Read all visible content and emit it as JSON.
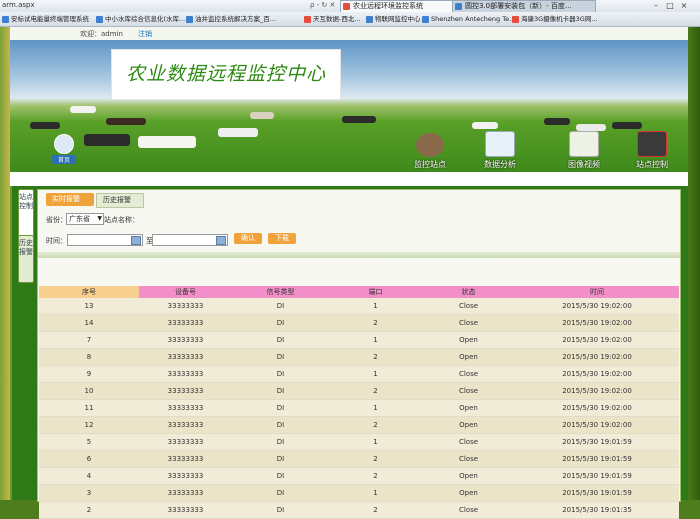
{
  "browser": {
    "url": "arm.aspx",
    "search_hint": "ρ - ↻ ✕",
    "tabs": [
      {
        "label": "农业远程环境监控系统",
        "active": true
      },
      {
        "label": "圆控3.0部署安装包（新）- 百度...",
        "active": false
      }
    ],
    "favorites": [
      "安标试电能量终端管理系统",
      "中小水库综合信息化(水库...",
      "油井监控系统解决方案_百...",
      "天互数据-西北...",
      "物联网监控中心",
      "Shenzhen Antecheng Te...",
      "海康3G摄像机卡器3G网..."
    ]
  },
  "header": {
    "welcome": "欢迎：admin",
    "logout": "注销"
  },
  "banner": {
    "title": "农业数据远程监控中心",
    "home_label": "首页",
    "nav": [
      {
        "label": "监控站点",
        "icon": "monitor-site-icon",
        "color": "#8a6a4a"
      },
      {
        "label": "数据分析",
        "icon": "chart-icon",
        "color": "#e8f0f8"
      },
      {
        "label": "图像视频",
        "icon": "photo-icon",
        "color": "#eef2e4"
      },
      {
        "label": "站点控制",
        "icon": "station-control-icon",
        "color": "#3a3a3a"
      }
    ]
  },
  "sidebar": {
    "tabs": [
      "站点控制",
      "历史报警"
    ]
  },
  "panel": {
    "crumbs": [
      "实时报警",
      "历史报警"
    ],
    "province_label": "省份：",
    "province_value": "广东省",
    "site_label": "站点名称：",
    "time_label": "时间：",
    "to_label": "至",
    "confirm_button": "确认",
    "download_button": "下载"
  },
  "table": {
    "columns": [
      "序号",
      "设备号",
      "信号类型",
      "端口",
      "状态",
      "时间"
    ],
    "header_colors": [
      "#f7cf8f",
      "#f28fc9",
      "#f28fc9",
      "#f28fc9",
      "#f28fc9",
      "#f28fc9"
    ],
    "rows": [
      [
        "13",
        "33333333",
        "DI",
        "1",
        "Close",
        "2015/5/30 19:02:00"
      ],
      [
        "14",
        "33333333",
        "DI",
        "2",
        "Close",
        "2015/5/30 19:02:00"
      ],
      [
        "7",
        "33333333",
        "DI",
        "1",
        "Open",
        "2015/5/30 19:02:00"
      ],
      [
        "8",
        "33333333",
        "DI",
        "2",
        "Open",
        "2015/5/30 19:02:00"
      ],
      [
        "9",
        "33333333",
        "DI",
        "1",
        "Close",
        "2015/5/30 19:02:00"
      ],
      [
        "10",
        "33333333",
        "DI",
        "2",
        "Close",
        "2015/5/30 19:02:00"
      ],
      [
        "11",
        "33333333",
        "DI",
        "1",
        "Open",
        "2015/5/30 19:02:00"
      ],
      [
        "12",
        "33333333",
        "DI",
        "2",
        "Open",
        "2015/5/30 19:02:00"
      ],
      [
        "5",
        "33333333",
        "DI",
        "1",
        "Close",
        "2015/5/30 19:01:59"
      ],
      [
        "6",
        "33333333",
        "DI",
        "2",
        "Close",
        "2015/5/30 19:01:59"
      ],
      [
        "4",
        "33333333",
        "DI",
        "2",
        "Open",
        "2015/5/30 19:01:59"
      ],
      [
        "3",
        "33333333",
        "DI",
        "1",
        "Open",
        "2015/5/30 19:01:59"
      ],
      [
        "2",
        "33333333",
        "DI",
        "2",
        "Close",
        "2015/5/30 19:01:35"
      ]
    ]
  }
}
